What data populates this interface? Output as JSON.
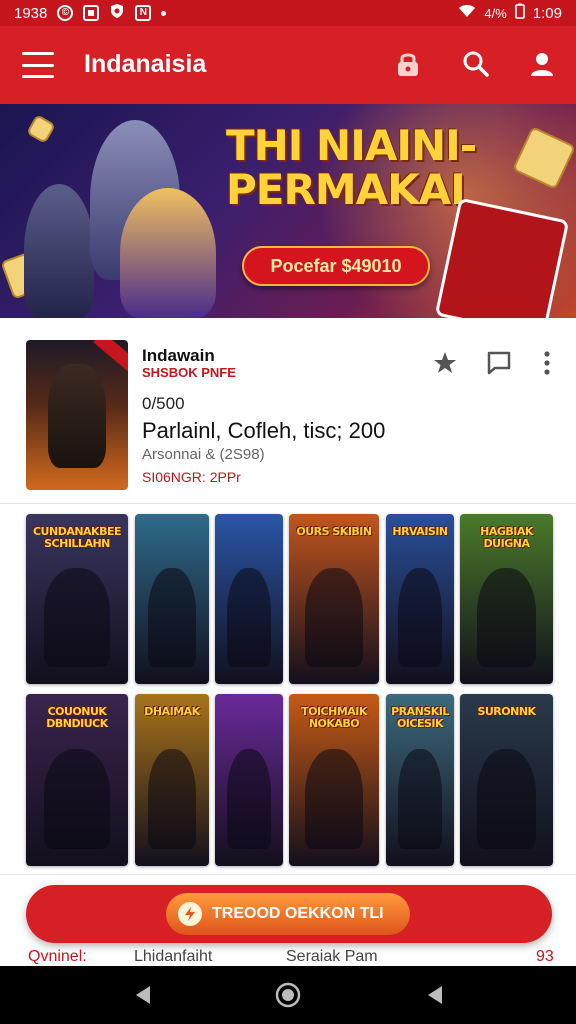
{
  "status_bar": {
    "time_left": "1938",
    "time_right": "1:09",
    "battery": "4/%",
    "icons": [
      "copyright-icon",
      "square-icon",
      "shield-icon",
      "n-icon",
      "wifi-icon",
      "signal-icon",
      "battery-icon"
    ]
  },
  "app_bar": {
    "title": "Indanaisia",
    "icons": [
      "menu-icon",
      "lock-icon",
      "search-icon",
      "person-icon"
    ]
  },
  "banner": {
    "title": "THI NIAINI- PERMAKAI",
    "button_label": "Pocefar $49010",
    "colors": {
      "title": "#ffd23a",
      "button": "#d4151d"
    }
  },
  "detail": {
    "title": "Indawain",
    "subtitle": "SHSBOK PNFE",
    "code": "0/500",
    "description": "Parlainl, Cofleh, tisc; 200",
    "meta": "Arsonnai & (2S98)",
    "red_line": "SI06NGR: 2PPr",
    "actions": [
      "star-icon",
      "comment-icon",
      "more-vertical-icon"
    ]
  },
  "grid": {
    "row1": [
      {
        "label": "CUNDANAKBEE SCHILLAHN",
        "bg": "#3a3560"
      },
      {
        "label": "",
        "bg": "#2f6b8a"
      },
      {
        "label": "",
        "bg": "#2a56a8"
      },
      {
        "label": "OURS SKIBIN",
        "bg": "#c2551f"
      },
      {
        "label": "HRVAISIN",
        "bg": "#2a4f9a"
      },
      {
        "label": "HAGBIAK DUIGNA",
        "bg": "#4a7a2a"
      }
    ],
    "row2": [
      {
        "label": "COUONUK DBNDIUCK",
        "bg": "#3a244e"
      },
      {
        "label": "DHAIMAK",
        "bg": "#a8741c"
      },
      {
        "label": "",
        "bg": "#6a2a9a"
      },
      {
        "label": "TOICHMAIK NOKABO",
        "bg": "#c65a16"
      },
      {
        "label": "PRANSKIL OICESIK",
        "bg": "#3c6a7e"
      },
      {
        "label": "SURONNK",
        "bg": "#2a3a4a"
      }
    ]
  },
  "cta": {
    "label": "TREOOD OEKKON TLI"
  },
  "tabs": [
    "Qvninel:",
    "Lhidanfaiht",
    "Seraiak Pam",
    "93"
  ],
  "nav": [
    "back-icon",
    "home-icon",
    "recents-icon"
  ]
}
